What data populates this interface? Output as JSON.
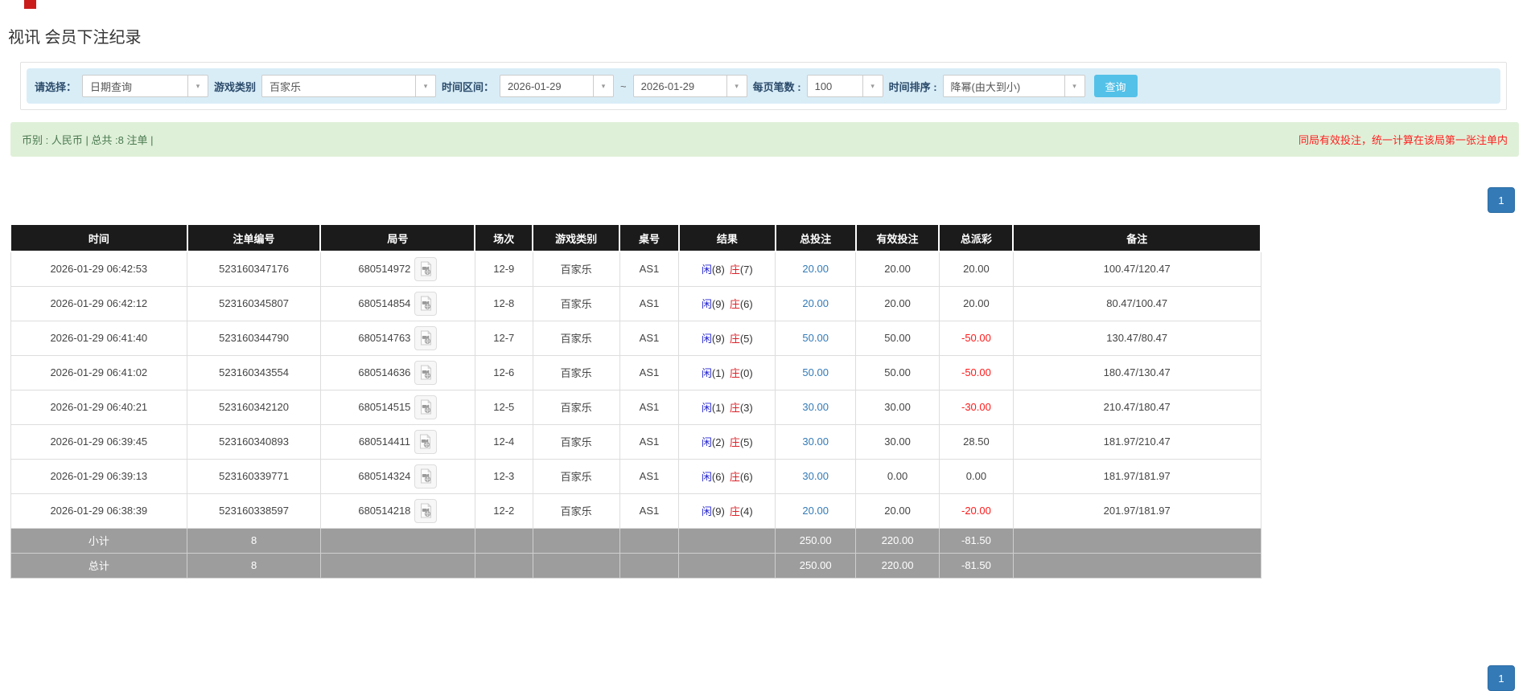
{
  "page": {
    "title": "视讯 会员下注纪录"
  },
  "filters": {
    "select_label": "请选择：",
    "select_value": "日期查询",
    "game_type_label": "游戏类别",
    "game_type_value": "百家乐",
    "time_range_label": "时间区间：",
    "date_from": "2026-01-29",
    "date_to": "2026-01-29",
    "range_separator": "~",
    "page_size_label": "每页笔数 :",
    "page_size_value": "100",
    "sort_label": "时间排序 :",
    "sort_value": "降幂(由大到小)",
    "search_button": "查询"
  },
  "summary": {
    "left_text": "币别 : 人民币 | 总共 :8 注单 |",
    "right_notice": "同局有效投注，统一计算在该局第一张注单内"
  },
  "pagination": {
    "current_page": "1"
  },
  "icons": {
    "dropdown_arrow": "caret-down-icon",
    "round_video": "video-file-icon",
    "top_left_fragment": "red-logo-fragment"
  },
  "colors": {
    "filter_bg": "#d9edf7",
    "search_button": "#54c1e8",
    "summary_bg": "#dff0d8",
    "summary_text": "#4a7a50",
    "notice_red": "#ff1f1f",
    "header_bg": "#1b1b1b",
    "footer_bg": "#9d9d9d",
    "pagination_blue": "#337ab7",
    "bet_link_blue": "#337ab7",
    "player_blue": "#2525d0",
    "banker_red": "#d9232a",
    "negative_red": "#ff1a1a"
  },
  "table": {
    "headers": [
      "时间",
      "注单编号",
      "局号",
      "场次",
      "游戏类别",
      "桌号",
      "结果",
      "总投注",
      "有效投注",
      "总派彩",
      "备注"
    ],
    "rows": [
      {
        "time": "2026-01-29 06:42:53",
        "bet_no": "523160347176",
        "round_no": "680514972",
        "session": "12-9",
        "game": "百家乐",
        "table_no": "AS1",
        "player_label": "闲",
        "player_score": "(8)",
        "banker_label": "庄",
        "banker_score": "(7)",
        "total_bet": "20.00",
        "valid_bet": "20.00",
        "payout": "20.00",
        "note": "100.47/120.47"
      },
      {
        "time": "2026-01-29 06:42:12",
        "bet_no": "523160345807",
        "round_no": "680514854",
        "session": "12-8",
        "game": "百家乐",
        "table_no": "AS1",
        "player_label": "闲",
        "player_score": "(9)",
        "banker_label": "庄",
        "banker_score": "(6)",
        "total_bet": "20.00",
        "valid_bet": "20.00",
        "payout": "20.00",
        "note": "80.47/100.47"
      },
      {
        "time": "2026-01-29 06:41:40",
        "bet_no": "523160344790",
        "round_no": "680514763",
        "session": "12-7",
        "game": "百家乐",
        "table_no": "AS1",
        "player_label": "闲",
        "player_score": "(9)",
        "banker_label": "庄",
        "banker_score": "(5)",
        "total_bet": "50.00",
        "valid_bet": "50.00",
        "payout": "-50.00",
        "note": "130.47/80.47"
      },
      {
        "time": "2026-01-29 06:41:02",
        "bet_no": "523160343554",
        "round_no": "680514636",
        "session": "12-6",
        "game": "百家乐",
        "table_no": "AS1",
        "player_label": "闲",
        "player_score": "(1)",
        "banker_label": "庄",
        "banker_score": "(0)",
        "total_bet": "50.00",
        "valid_bet": "50.00",
        "payout": "-50.00",
        "note": "180.47/130.47"
      },
      {
        "time": "2026-01-29 06:40:21",
        "bet_no": "523160342120",
        "round_no": "680514515",
        "session": "12-5",
        "game": "百家乐",
        "table_no": "AS1",
        "player_label": "闲",
        "player_score": "(1)",
        "banker_label": "庄",
        "banker_score": "(3)",
        "total_bet": "30.00",
        "valid_bet": "30.00",
        "payout": "-30.00",
        "note": "210.47/180.47"
      },
      {
        "time": "2026-01-29 06:39:45",
        "bet_no": "523160340893",
        "round_no": "680514411",
        "session": "12-4",
        "game": "百家乐",
        "table_no": "AS1",
        "player_label": "闲",
        "player_score": "(2)",
        "banker_label": "庄",
        "banker_score": "(5)",
        "total_bet": "30.00",
        "valid_bet": "30.00",
        "payout": "28.50",
        "note": "181.97/210.47"
      },
      {
        "time": "2026-01-29 06:39:13",
        "bet_no": "523160339771",
        "round_no": "680514324",
        "session": "12-3",
        "game": "百家乐",
        "table_no": "AS1",
        "player_label": "闲",
        "player_score": "(6)",
        "banker_label": "庄",
        "banker_score": "(6)",
        "total_bet": "30.00",
        "valid_bet": "0.00",
        "payout": "0.00",
        "note": "181.97/181.97"
      },
      {
        "time": "2026-01-29 06:38:39",
        "bet_no": "523160338597",
        "round_no": "680514218",
        "session": "12-2",
        "game": "百家乐",
        "table_no": "AS1",
        "player_label": "闲",
        "player_score": "(9)",
        "banker_label": "庄",
        "banker_score": "(4)",
        "total_bet": "20.00",
        "valid_bet": "20.00",
        "payout": "-20.00",
        "note": "201.97/181.97"
      }
    ],
    "subtotal": {
      "label": "小计",
      "count": "8",
      "total_bet": "250.00",
      "valid_bet": "220.00",
      "payout": "-81.50"
    },
    "total": {
      "label": "总计",
      "count": "8",
      "total_bet": "250.00",
      "valid_bet": "220.00",
      "payout": "-81.50"
    }
  }
}
